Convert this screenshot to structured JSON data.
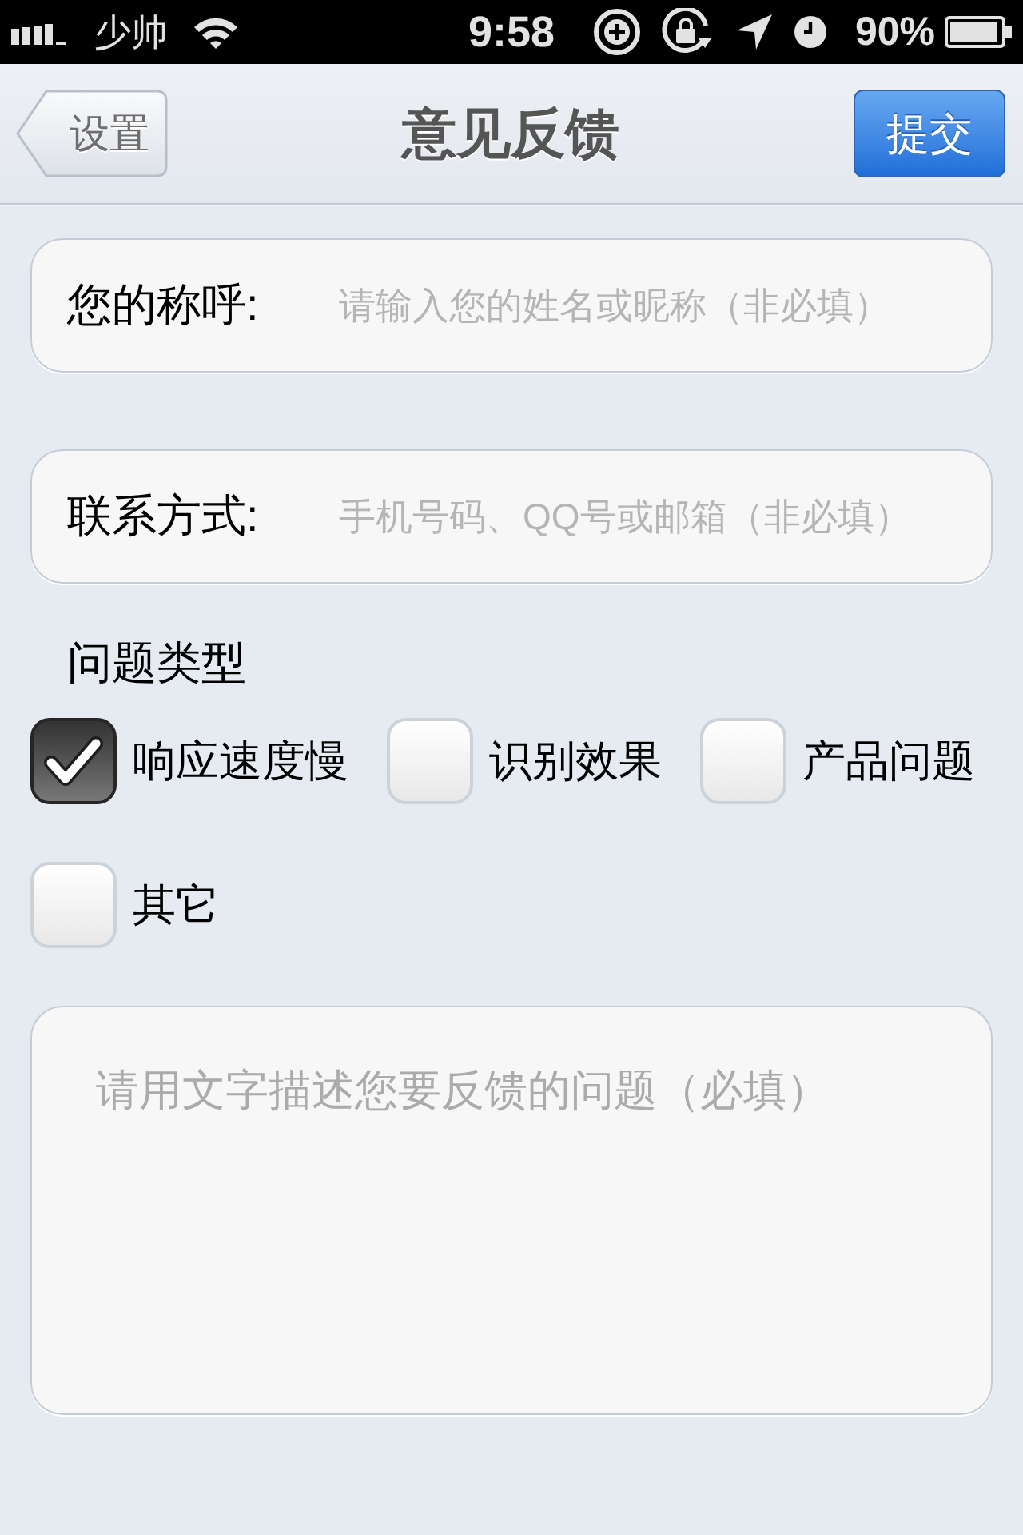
{
  "status_bar": {
    "carrier": "少帅",
    "time": "9:58",
    "battery": "90%"
  },
  "nav_bar": {
    "back_button": "设置",
    "title": "意见反馈",
    "submit_button": "提交"
  },
  "fields": [
    {
      "label": "您的称呼:",
      "placeholder": "请输入您的姓名或昵称（非必填）"
    },
    {
      "label": "联系方式:",
      "placeholder": "手机号码、QQ号或邮箱（非必填）"
    }
  ],
  "problem_type": {
    "heading": "问题类型",
    "options": [
      {
        "label": "响应速度慢",
        "checked": true
      },
      {
        "label": "识别效果",
        "checked": false
      },
      {
        "label": "产品问题",
        "checked": false
      },
      {
        "label": "其它",
        "checked": false
      }
    ]
  },
  "description": {
    "placeholder": "请用文字描述您要反馈的问题（必填）"
  }
}
